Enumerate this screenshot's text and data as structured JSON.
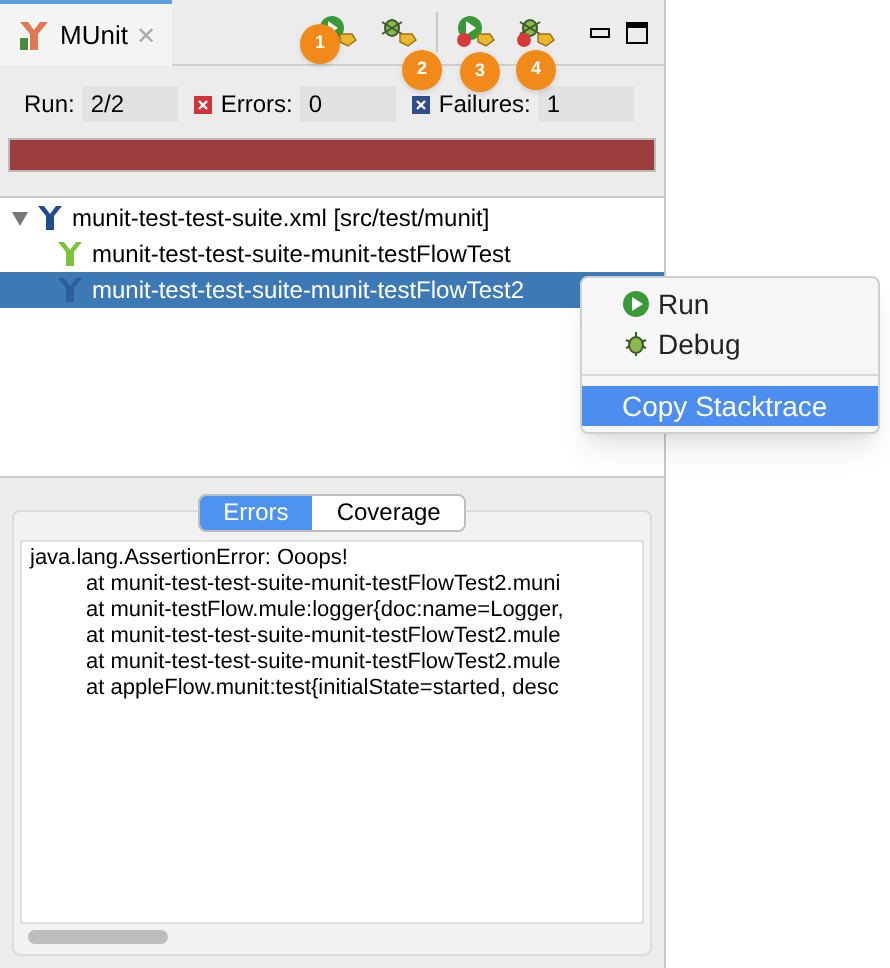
{
  "view_tab": {
    "title": "MUnit",
    "close": "✕"
  },
  "toolbar": {
    "badges": [
      "1",
      "2",
      "3",
      "4"
    ]
  },
  "counters": [
    {
      "label": "Run:",
      "value": "2/2",
      "kind": "run"
    },
    {
      "label": "Errors:",
      "value": "0",
      "kind": "errors"
    },
    {
      "label": "Failures:",
      "value": "1",
      "kind": "failures"
    }
  ],
  "progress": {
    "level": 1,
    "failed": true
  },
  "tree": [
    {
      "label": "munit-test-test-suite.xml [src/test/munit]",
      "kind": "suite",
      "expanded": true,
      "selected": false,
      "children": [
        {
          "label": "munit-test-test-suite-munit-testFlowTest",
          "kind": "passed",
          "selected": false
        },
        {
          "label": "munit-test-test-suite-munit-testFlowTest2",
          "kind": "failed",
          "selected": true
        }
      ]
    }
  ],
  "context_menu": [
    {
      "label": "Run",
      "kind": "run",
      "selected": false
    },
    {
      "label": "Debug",
      "kind": "debug",
      "selected": false
    },
    {
      "label": "Copy Stacktrace",
      "kind": "plain",
      "selected": true
    }
  ],
  "tabs": [
    {
      "label": "Errors",
      "selected": true
    },
    {
      "label": "Coverage",
      "selected": false
    }
  ],
  "stacktrace": {
    "message": "java.lang.AssertionError: Ooops!",
    "frames": [
      "at munit-test-test-suite-munit-testFlowTest2.muni",
      "at munit-testFlow.mule:logger{doc:name=Logger,",
      "at munit-test-test-suite-munit-testFlowTest2.mule",
      "at munit-test-test-suite-munit-testFlowTest2.mule",
      "at appleFlow.munit:test{initialState=started, desc"
    ]
  }
}
